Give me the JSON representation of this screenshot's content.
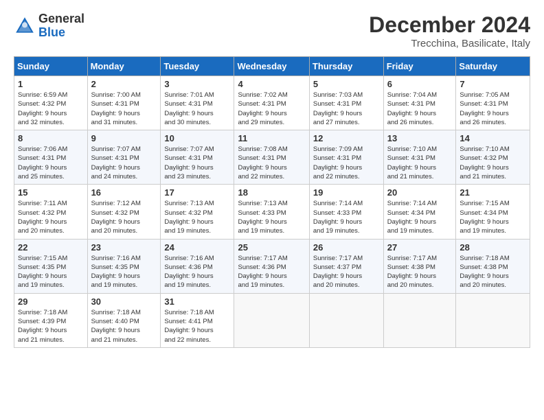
{
  "logo": {
    "general": "General",
    "blue": "Blue"
  },
  "title": {
    "month": "December 2024",
    "location": "Trecchina, Basilicate, Italy"
  },
  "weekdays": [
    "Sunday",
    "Monday",
    "Tuesday",
    "Wednesday",
    "Thursday",
    "Friday",
    "Saturday"
  ],
  "weeks": [
    [
      {
        "day": "1",
        "info": "Sunrise: 6:59 AM\nSunset: 4:32 PM\nDaylight: 9 hours\nand 32 minutes."
      },
      {
        "day": "2",
        "info": "Sunrise: 7:00 AM\nSunset: 4:31 PM\nDaylight: 9 hours\nand 31 minutes."
      },
      {
        "day": "3",
        "info": "Sunrise: 7:01 AM\nSunset: 4:31 PM\nDaylight: 9 hours\nand 30 minutes."
      },
      {
        "day": "4",
        "info": "Sunrise: 7:02 AM\nSunset: 4:31 PM\nDaylight: 9 hours\nand 29 minutes."
      },
      {
        "day": "5",
        "info": "Sunrise: 7:03 AM\nSunset: 4:31 PM\nDaylight: 9 hours\nand 27 minutes."
      },
      {
        "day": "6",
        "info": "Sunrise: 7:04 AM\nSunset: 4:31 PM\nDaylight: 9 hours\nand 26 minutes."
      },
      {
        "day": "7",
        "info": "Sunrise: 7:05 AM\nSunset: 4:31 PM\nDaylight: 9 hours\nand 26 minutes."
      }
    ],
    [
      {
        "day": "8",
        "info": "Sunrise: 7:06 AM\nSunset: 4:31 PM\nDaylight: 9 hours\nand 25 minutes."
      },
      {
        "day": "9",
        "info": "Sunrise: 7:07 AM\nSunset: 4:31 PM\nDaylight: 9 hours\nand 24 minutes."
      },
      {
        "day": "10",
        "info": "Sunrise: 7:07 AM\nSunset: 4:31 PM\nDaylight: 9 hours\nand 23 minutes."
      },
      {
        "day": "11",
        "info": "Sunrise: 7:08 AM\nSunset: 4:31 PM\nDaylight: 9 hours\nand 22 minutes."
      },
      {
        "day": "12",
        "info": "Sunrise: 7:09 AM\nSunset: 4:31 PM\nDaylight: 9 hours\nand 22 minutes."
      },
      {
        "day": "13",
        "info": "Sunrise: 7:10 AM\nSunset: 4:31 PM\nDaylight: 9 hours\nand 21 minutes."
      },
      {
        "day": "14",
        "info": "Sunrise: 7:10 AM\nSunset: 4:32 PM\nDaylight: 9 hours\nand 21 minutes."
      }
    ],
    [
      {
        "day": "15",
        "info": "Sunrise: 7:11 AM\nSunset: 4:32 PM\nDaylight: 9 hours\nand 20 minutes."
      },
      {
        "day": "16",
        "info": "Sunrise: 7:12 AM\nSunset: 4:32 PM\nDaylight: 9 hours\nand 20 minutes."
      },
      {
        "day": "17",
        "info": "Sunrise: 7:13 AM\nSunset: 4:32 PM\nDaylight: 9 hours\nand 19 minutes."
      },
      {
        "day": "18",
        "info": "Sunrise: 7:13 AM\nSunset: 4:33 PM\nDaylight: 9 hours\nand 19 minutes."
      },
      {
        "day": "19",
        "info": "Sunrise: 7:14 AM\nSunset: 4:33 PM\nDaylight: 9 hours\nand 19 minutes."
      },
      {
        "day": "20",
        "info": "Sunrise: 7:14 AM\nSunset: 4:34 PM\nDaylight: 9 hours\nand 19 minutes."
      },
      {
        "day": "21",
        "info": "Sunrise: 7:15 AM\nSunset: 4:34 PM\nDaylight: 9 hours\nand 19 minutes."
      }
    ],
    [
      {
        "day": "22",
        "info": "Sunrise: 7:15 AM\nSunset: 4:35 PM\nDaylight: 9 hours\nand 19 minutes."
      },
      {
        "day": "23",
        "info": "Sunrise: 7:16 AM\nSunset: 4:35 PM\nDaylight: 9 hours\nand 19 minutes."
      },
      {
        "day": "24",
        "info": "Sunrise: 7:16 AM\nSunset: 4:36 PM\nDaylight: 9 hours\nand 19 minutes."
      },
      {
        "day": "25",
        "info": "Sunrise: 7:17 AM\nSunset: 4:36 PM\nDaylight: 9 hours\nand 19 minutes."
      },
      {
        "day": "26",
        "info": "Sunrise: 7:17 AM\nSunset: 4:37 PM\nDaylight: 9 hours\nand 20 minutes."
      },
      {
        "day": "27",
        "info": "Sunrise: 7:17 AM\nSunset: 4:38 PM\nDaylight: 9 hours\nand 20 minutes."
      },
      {
        "day": "28",
        "info": "Sunrise: 7:18 AM\nSunset: 4:38 PM\nDaylight: 9 hours\nand 20 minutes."
      }
    ],
    [
      {
        "day": "29",
        "info": "Sunrise: 7:18 AM\nSunset: 4:39 PM\nDaylight: 9 hours\nand 21 minutes."
      },
      {
        "day": "30",
        "info": "Sunrise: 7:18 AM\nSunset: 4:40 PM\nDaylight: 9 hours\nand 21 minutes."
      },
      {
        "day": "31",
        "info": "Sunrise: 7:18 AM\nSunset: 4:41 PM\nDaylight: 9 hours\nand 22 minutes."
      },
      null,
      null,
      null,
      null
    ]
  ]
}
